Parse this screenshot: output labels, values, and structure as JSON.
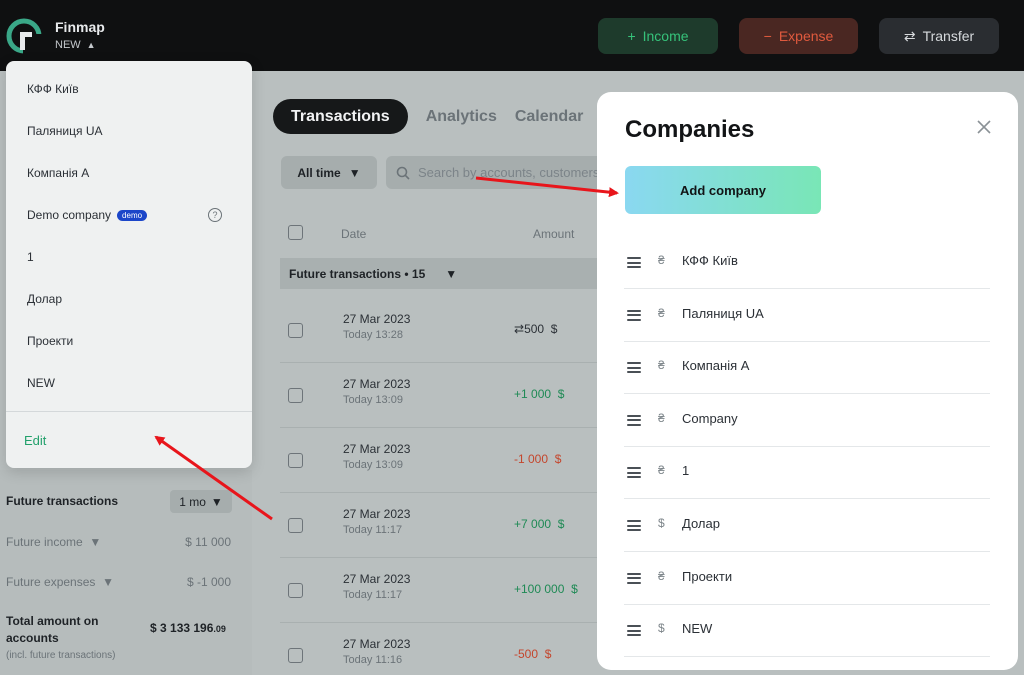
{
  "header": {
    "brand": "Finmap",
    "company_selector": "NEW",
    "income_label": "Income",
    "expense_label": "Expense",
    "transfer_label": "Transfer",
    "colors": {
      "income": "#36c27a",
      "expense": "#e05a3e"
    }
  },
  "company_dropdown": {
    "items": [
      {
        "label": "КФФ Київ"
      },
      {
        "label": "Паляниця UA"
      },
      {
        "label": "Компанія А"
      },
      {
        "label": "Demo company",
        "badge": "demo",
        "help_icon": "?"
      },
      {
        "label": "1"
      },
      {
        "label": "Долар"
      },
      {
        "label": "Проекти"
      },
      {
        "label": "NEW"
      }
    ],
    "edit_label": "Edit"
  },
  "main": {
    "tabs": [
      "Transactions",
      "Analytics",
      "Calendar"
    ],
    "period_filter": "All time",
    "search_placeholder": "Search by accounts, customers",
    "columns": {
      "date": "Date",
      "amount": "Amount"
    },
    "group_label": "Future transactions • 15",
    "transactions": [
      {
        "date": "27 Mar 2023",
        "time": "Today 13:28",
        "amount": "500",
        "currency": "$",
        "type": "transfer"
      },
      {
        "date": "27 Mar 2023",
        "time": "Today 13:09",
        "amount": "+1 000",
        "currency": "$",
        "type": "income"
      },
      {
        "date": "27 Mar 2023",
        "time": "Today 13:09",
        "amount": "-1 000",
        "currency": "$",
        "type": "expense"
      },
      {
        "date": "27 Mar 2023",
        "time": "Today 11:17",
        "amount": "+7 000",
        "currency": "$",
        "type": "income"
      },
      {
        "date": "27 Mar 2023",
        "time": "Today 11:17",
        "amount": "+100 000",
        "currency": "$",
        "type": "income"
      },
      {
        "date": "27 Mar 2023",
        "time": "Today 11:16",
        "amount": "-500",
        "currency": "$",
        "type": "expense"
      }
    ]
  },
  "sidebar_stats": {
    "future_transactions_label": "Future transactions",
    "period": "1 mo",
    "future_income_label": "Future income",
    "future_income_value": "$  11 000",
    "future_expenses_label": "Future expenses",
    "future_expenses_value": "$  -1 000",
    "total_label": "Total amount on accounts",
    "total_value": "$  3 133 196",
    "total_cents": ".09",
    "total_note": "(incl. future transactions)"
  },
  "companies_modal": {
    "title": "Companies",
    "add_label": "Add company",
    "companies": [
      {
        "currency": "₴",
        "name": "КФФ Київ"
      },
      {
        "currency": "₴",
        "name": "Паляниця UA"
      },
      {
        "currency": "₴",
        "name": "Компанія А"
      },
      {
        "currency": "₴",
        "name": "Company"
      },
      {
        "currency": "₴",
        "name": "1"
      },
      {
        "currency": "$",
        "name": "Долар"
      },
      {
        "currency": "₴",
        "name": "Проекти"
      },
      {
        "currency": "$",
        "name": "NEW"
      }
    ]
  },
  "annotation_color": "#e8151b"
}
